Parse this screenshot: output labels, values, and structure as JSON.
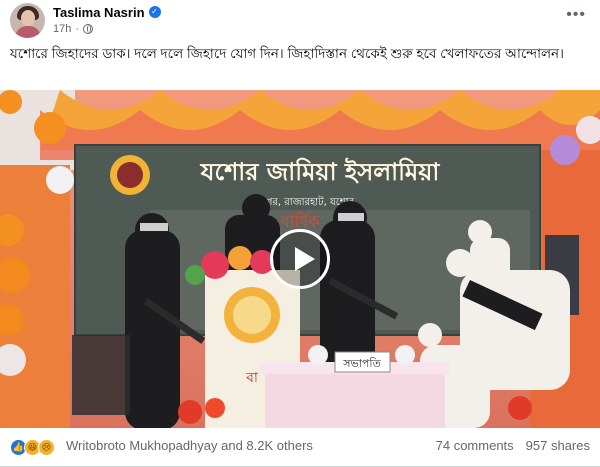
{
  "post": {
    "author": "Taslima Nasrin",
    "time": "17h",
    "text": "যশোরে জিহাদের ডাক। দলে দলে জিহাদে যোগ দিন। জিহাদিস্তান থেকেই শুরু হবে খেলাফতের আন্দোলন।"
  },
  "video": {
    "banner_title": "যশোর জামিয়া ইসলামিয়া",
    "banner_subtitle": "রামনগর, রাজারহাট, যশোর",
    "banner_partial": "বার্ষিক",
    "desk_sign": "সভাপতি",
    "podium_text": "বা"
  },
  "footer": {
    "reactions_text": "Writobroto Mukhopadhyay and 8.2K others",
    "comments": "74 comments",
    "shares": "957 shares"
  },
  "icons": [
    "verified-icon",
    "globe-icon",
    "more-options-icon",
    "play-icon",
    "like-reaction-icon",
    "haha-reaction-icon",
    "sad-reaction-icon"
  ],
  "colors": {
    "link_blue": "#1b74e4",
    "meta_gray": "#65676b"
  }
}
